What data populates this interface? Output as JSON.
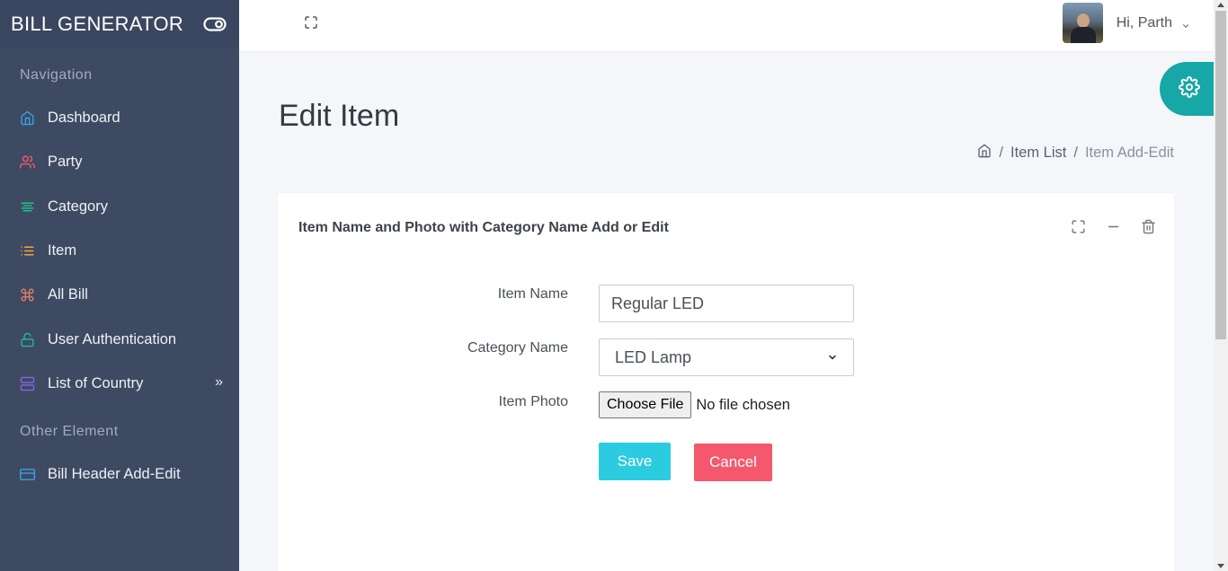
{
  "app": {
    "title": "BILL GENERATOR"
  },
  "sidebar": {
    "heading_nav": "Navigation",
    "items": [
      {
        "label": "Dashboard",
        "icon": "home-icon",
        "color": "#3aa0e8"
      },
      {
        "label": "Party",
        "icon": "users-icon",
        "color": "#f05a6a"
      },
      {
        "label": "Category",
        "icon": "align-icon",
        "color": "#22c38e"
      },
      {
        "label": "Item",
        "icon": "list-icon",
        "color": "#f7a23b"
      },
      {
        "label": "All Bill",
        "icon": "command-icon",
        "color": "#d67f64"
      },
      {
        "label": "User Authentication",
        "icon": "unlock-icon",
        "color": "#1fb9a9"
      },
      {
        "label": "List of Country",
        "icon": "server-icon",
        "color": "#8a63e8",
        "chevron": "»"
      }
    ],
    "heading_other": "Other Element",
    "other_items": [
      {
        "label": "Bill Header Add-Edit",
        "icon": "credit-card-icon",
        "color": "#3aa0e8"
      }
    ]
  },
  "topbar": {
    "user_greeting": "Hi, Parth"
  },
  "page": {
    "title": "Edit Item",
    "breadcrumb": {
      "item1": "Item List",
      "item2": "Item Add-Edit"
    }
  },
  "card": {
    "title": "Item Name and Photo with Category Name Add or Edit",
    "form": {
      "item_name_label": "Item Name",
      "item_name_value": "Regular LED",
      "category_label": "Category Name",
      "category_value": "LED Lamp",
      "photo_label": "Item Photo",
      "file_button": "Choose File",
      "file_status": "No file chosen",
      "save_label": "Save",
      "cancel_label": "Cancel"
    }
  },
  "colors": {
    "sidebar_bg": "#3e4a61",
    "accent_teal": "#16a7a6",
    "save": "#2bcbe0",
    "cancel": "#f5586d"
  }
}
